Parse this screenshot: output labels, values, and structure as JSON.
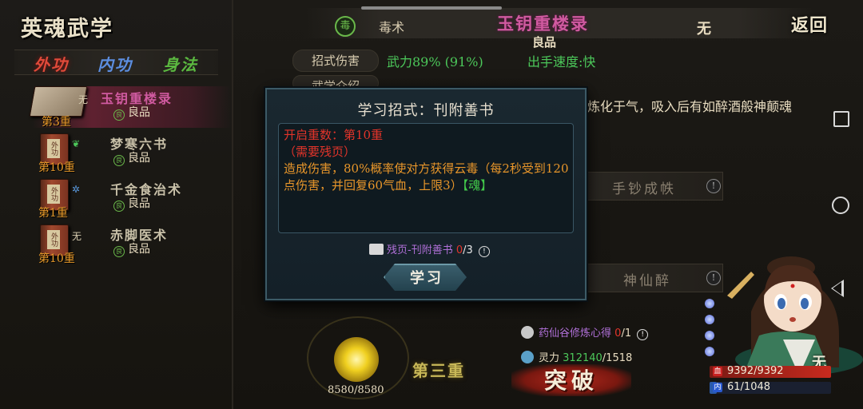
{
  "left_panel": {
    "title": "英魂武学",
    "tabs": [
      "外功",
      "内功",
      "身法"
    ],
    "skills": [
      {
        "level": "第3重",
        "name": "玉钥重楼录",
        "grade": "良品",
        "kind": "无",
        "name_color": "#d05aa0"
      },
      {
        "level": "第10重",
        "name": "梦寒六书",
        "grade": "良品",
        "kind": "毒",
        "name_color": "#c8c0a8"
      },
      {
        "level": "第1重",
        "name": "千金食治术",
        "grade": "良品",
        "kind": "医",
        "name_color": "#c8c0a8"
      },
      {
        "level": "第10重",
        "name": "赤脚医术",
        "grade": "良品",
        "kind": "无",
        "name_color": "#c8c0a8"
      }
    ],
    "book_label": "外功"
  },
  "header": {
    "category": "毒术",
    "skill_title": "玉钥重楼录",
    "grade": "良品",
    "none_label": "无",
    "back_label": "返回"
  },
  "stats": {
    "damage_label": "招式伤害",
    "damage_value": "武力89%  (91%)",
    "speed": "出手速度:快",
    "intro_label": "武学介绍",
    "intro_text": "炼化于气，吸入后有如醉酒般神颠魂"
  },
  "side_skills": [
    {
      "name": "手钞成帙"
    },
    {
      "name": "神仙醉"
    }
  ],
  "modal": {
    "title": "学习招式：刊附善书",
    "req_layer": "开启重数：第10重",
    "req_fragment": "（需要残页）",
    "effect": "造成伤害，80%概率使对方获得云毒（每2秒受到120点伤害，并回复60气血，上限3）",
    "soul_tag": "【魂】",
    "fragment_name": "残页-刊附善书",
    "fragment_have": "0",
    "fragment_need": "/3",
    "learn_label": "学习"
  },
  "breakthrough": {
    "orb_value": "8580/8580",
    "stage": "第三重",
    "req1_name": "药仙谷修炼心得",
    "req1_have": "0",
    "req1_need": "/1",
    "req2_label": "灵力",
    "req2_have": "312140",
    "req2_need": "/1518",
    "button_label": "突破"
  },
  "character": {
    "name": "无",
    "hp": "9392/9392",
    "mp": "61/1048",
    "mp_fraction": 0.06
  }
}
